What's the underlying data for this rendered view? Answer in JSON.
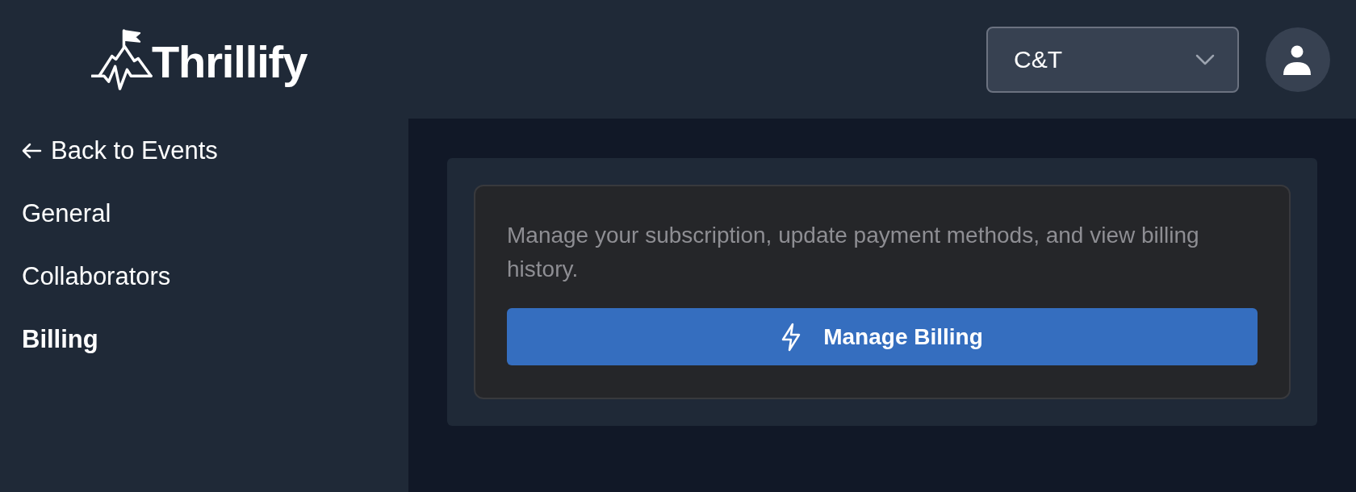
{
  "header": {
    "logo_text": "Thrillify",
    "workspace_select": {
      "value": "C&T"
    }
  },
  "sidebar": {
    "back_link": {
      "label": "Back to Events"
    },
    "items": [
      {
        "label": "General",
        "selected": false
      },
      {
        "label": "Collaborators",
        "selected": false
      },
      {
        "label": "Billing",
        "selected": true
      }
    ]
  },
  "billing": {
    "description": "Manage your subscription, update payment methods, and view billing history.",
    "button": {
      "label": "Manage Billing"
    }
  }
}
